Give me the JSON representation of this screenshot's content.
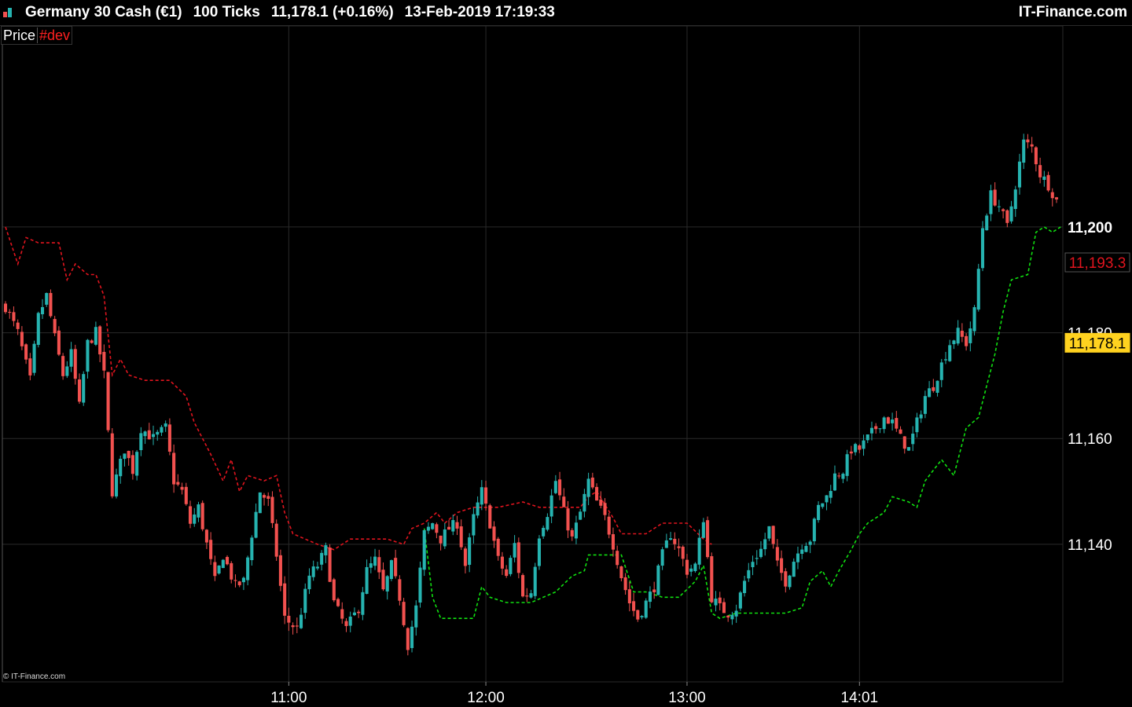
{
  "header": {
    "instrument": "Germany 30 Cash (€1)",
    "interval": "100 Ticks",
    "last": "11,178.1 (+0.16%)",
    "datetime": "13-Feb-2019 17:19:33",
    "brand": "IT-Finance.com",
    "icon": "bar-chart-icon"
  },
  "legend": {
    "price": "Price",
    "indicator": "#dev"
  },
  "copyright": "© IT-Finance.com",
  "colors": {
    "background": "#000000",
    "grid": "#2a2a2a",
    "up": "#26b3b0",
    "down": "#f2514f",
    "upper_band": "#e0141e",
    "lower_band": "#10e010",
    "last_price_tag": "#ffd21f",
    "band_tag": "#e0141e"
  },
  "chart_data": {
    "type": "candlestick",
    "ylim": [
      11114,
      11238
    ],
    "y_ticks": [
      {
        "value": 11140,
        "label": "11,140"
      },
      {
        "value": 11160,
        "label": "11,160"
      },
      {
        "value": 11180,
        "label": "11,180"
      },
      {
        "value": 11200,
        "label": "11,200"
      }
    ],
    "x_ticks": [
      {
        "index": 69,
        "label": "11:00"
      },
      {
        "index": 117,
        "label": "12:00"
      },
      {
        "index": 166,
        "label": "13:00"
      },
      {
        "index": 208,
        "label": "14:01"
      }
    ],
    "bar_count": 257,
    "price_anchors": [
      [
        0,
        11185
      ],
      [
        3,
        11180
      ],
      [
        6,
        11171
      ],
      [
        8,
        11183
      ],
      [
        10,
        11187
      ],
      [
        12,
        11179
      ],
      [
        14,
        11172
      ],
      [
        16,
        11176
      ],
      [
        18,
        11166
      ],
      [
        20,
        11178
      ],
      [
        22,
        11180
      ],
      [
        24,
        11172
      ],
      [
        26,
        11150
      ],
      [
        29,
        11158
      ],
      [
        31,
        11154
      ],
      [
        33,
        11162
      ],
      [
        36,
        11160
      ],
      [
        39,
        11162
      ],
      [
        41,
        11152
      ],
      [
        43,
        11150
      ],
      [
        45,
        11144
      ],
      [
        47,
        11147
      ],
      [
        49,
        11140
      ],
      [
        51,
        11133
      ],
      [
        53,
        11138
      ],
      [
        56,
        11132
      ],
      [
        58,
        11133
      ],
      [
        60,
        11142
      ],
      [
        62,
        11150
      ],
      [
        64,
        11148
      ],
      [
        66,
        11138
      ],
      [
        68,
        11126
      ],
      [
        71,
        11124
      ],
      [
        74,
        11134
      ],
      [
        76,
        11136
      ],
      [
        78,
        11139
      ],
      [
        80,
        11129
      ],
      [
        83,
        11124
      ],
      [
        86,
        11128
      ],
      [
        88,
        11135
      ],
      [
        90,
        11137
      ],
      [
        92,
        11131
      ],
      [
        94,
        11136
      ],
      [
        96,
        11130
      ],
      [
        98,
        11121
      ],
      [
        100,
        11128
      ],
      [
        102,
        11142
      ],
      [
        104,
        11144
      ],
      [
        106,
        11141
      ],
      [
        108,
        11143
      ],
      [
        110,
        11144
      ],
      [
        112,
        11136
      ],
      [
        114,
        11145
      ],
      [
        116,
        11150
      ],
      [
        118,
        11144
      ],
      [
        120,
        11137
      ],
      [
        122,
        11134
      ],
      [
        124,
        11140
      ],
      [
        126,
        11130
      ],
      [
        128,
        11131
      ],
      [
        130,
        11142
      ],
      [
        132,
        11146
      ],
      [
        134,
        11152
      ],
      [
        136,
        11146
      ],
      [
        138,
        11141
      ],
      [
        140,
        11146
      ],
      [
        142,
        11152
      ],
      [
        144,
        11148
      ],
      [
        146,
        11145
      ],
      [
        148,
        11140
      ],
      [
        150,
        11134
      ],
      [
        152,
        11129
      ],
      [
        154,
        11126
      ],
      [
        156,
        11129
      ],
      [
        158,
        11132
      ],
      [
        160,
        11138
      ],
      [
        162,
        11142
      ],
      [
        164,
        11139
      ],
      [
        166,
        11135
      ],
      [
        168,
        11136
      ],
      [
        170,
        11145
      ],
      [
        172,
        11130
      ],
      [
        174,
        11128
      ],
      [
        176,
        11127
      ],
      [
        178,
        11128
      ],
      [
        180,
        11133
      ],
      [
        182,
        11137
      ],
      [
        184,
        11139
      ],
      [
        186,
        11143
      ],
      [
        188,
        11136
      ],
      [
        190,
        11133
      ],
      [
        192,
        11137
      ],
      [
        194,
        11140
      ],
      [
        196,
        11141
      ],
      [
        198,
        11147
      ],
      [
        200,
        11149
      ],
      [
        202,
        11153
      ],
      [
        204,
        11154
      ],
      [
        206,
        11158
      ],
      [
        208,
        11158
      ],
      [
        210,
        11160
      ],
      [
        212,
        11162
      ],
      [
        214,
        11164
      ],
      [
        216,
        11163
      ],
      [
        218,
        11160
      ],
      [
        220,
        11158
      ],
      [
        222,
        11163
      ],
      [
        224,
        11168
      ],
      [
        226,
        11170
      ],
      [
        228,
        11174
      ],
      [
        230,
        11178
      ],
      [
        232,
        11180
      ],
      [
        234,
        11178
      ],
      [
        236,
        11184
      ],
      [
        238,
        11200
      ],
      [
        240,
        11206
      ],
      [
        242,
        11204
      ],
      [
        244,
        11200
      ],
      [
        246,
        11208
      ],
      [
        248,
        11216
      ],
      [
        250,
        11215
      ],
      [
        252,
        11210
      ],
      [
        254,
        11208
      ],
      [
        256,
        11205
      ]
    ],
    "upper_band": [
      [
        0,
        11200
      ],
      [
        3,
        11193
      ],
      [
        5,
        11198
      ],
      [
        8,
        11197
      ],
      [
        11,
        11197
      ],
      [
        13,
        11197
      ],
      [
        15,
        11190
      ],
      [
        17,
        11193
      ],
      [
        20,
        11191
      ],
      [
        22,
        11191
      ],
      [
        24,
        11187
      ],
      [
        26,
        11172
      ],
      [
        28,
        11175
      ],
      [
        30,
        11172
      ],
      [
        34,
        11171
      ],
      [
        40,
        11171
      ],
      [
        44,
        11168
      ],
      [
        46,
        11163
      ],
      [
        48,
        11160
      ],
      [
        50,
        11157
      ],
      [
        53,
        11152
      ],
      [
        55,
        11156
      ],
      [
        57,
        11150
      ],
      [
        59,
        11153
      ],
      [
        63,
        11152
      ],
      [
        66,
        11153
      ],
      [
        68,
        11146
      ],
      [
        70,
        11142
      ],
      [
        73,
        11141
      ],
      [
        76,
        11140
      ],
      [
        80,
        11139
      ],
      [
        84,
        11141
      ],
      [
        88,
        11141
      ],
      [
        93,
        11141
      ],
      [
        97,
        11140
      ],
      [
        99,
        11143
      ],
      [
        102,
        11144
      ],
      [
        105,
        11146
      ],
      [
        107,
        11144
      ],
      [
        110,
        11146
      ],
      [
        114,
        11147
      ],
      [
        120,
        11147
      ],
      [
        126,
        11148
      ],
      [
        130,
        11147
      ],
      [
        136,
        11147
      ],
      [
        140,
        11147
      ],
      [
        142,
        11149
      ],
      [
        144,
        11150
      ],
      [
        148,
        11145
      ],
      [
        150,
        11142
      ],
      [
        156,
        11142
      ],
      [
        160,
        11144
      ],
      [
        166,
        11144
      ],
      [
        170,
        11141
      ],
      [
        172,
        11140
      ]
    ],
    "lower_band": [
      [
        102,
        11143
      ],
      [
        104,
        11130
      ],
      [
        106,
        11126
      ],
      [
        110,
        11126
      ],
      [
        114,
        11126
      ],
      [
        116,
        11132
      ],
      [
        118,
        11130
      ],
      [
        122,
        11129
      ],
      [
        128,
        11129
      ],
      [
        134,
        11131
      ],
      [
        138,
        11134
      ],
      [
        141,
        11135
      ],
      [
        142,
        11138
      ],
      [
        146,
        11138
      ],
      [
        150,
        11138
      ],
      [
        153,
        11131
      ],
      [
        156,
        11131
      ],
      [
        160,
        11130
      ],
      [
        164,
        11130
      ],
      [
        168,
        11133
      ],
      [
        170,
        11136
      ],
      [
        172,
        11127
      ],
      [
        174,
        11126
      ],
      [
        178,
        11127
      ],
      [
        182,
        11127
      ],
      [
        186,
        11127
      ],
      [
        190,
        11127
      ],
      [
        194,
        11128
      ],
      [
        196,
        11133
      ],
      [
        199,
        11135
      ],
      [
        201,
        11132
      ],
      [
        203,
        11135
      ],
      [
        206,
        11139
      ],
      [
        208,
        11142
      ],
      [
        210,
        11144
      ],
      [
        214,
        11146
      ],
      [
        216,
        11149
      ],
      [
        220,
        11148
      ],
      [
        222,
        11147
      ],
      [
        224,
        11152
      ],
      [
        226,
        11154
      ],
      [
        228,
        11156
      ],
      [
        231,
        11153
      ],
      [
        234,
        11162
      ],
      [
        237,
        11164
      ],
      [
        239,
        11170
      ],
      [
        241,
        11176
      ],
      [
        243,
        11184
      ],
      [
        245,
        11190
      ],
      [
        249,
        11191
      ],
      [
        251,
        11199
      ],
      [
        253,
        11200
      ],
      [
        255,
        11199
      ],
      [
        257,
        11200
      ]
    ],
    "price_tags": [
      {
        "label": "11,193.3",
        "value": 11193.3,
        "kind": "band"
      },
      {
        "label": "11,178.1",
        "value": 11178.1,
        "kind": "last"
      }
    ]
  }
}
